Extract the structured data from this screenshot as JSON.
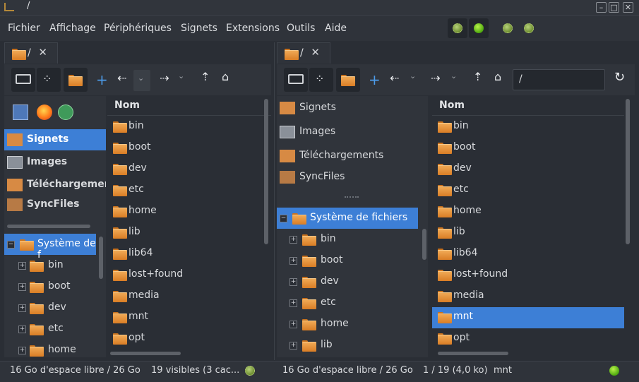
{
  "window": {
    "title": "/"
  },
  "menu": [
    "Fichier",
    "Affichage",
    "Périphériques",
    "Signets",
    "Extensions",
    "Outils",
    "Aide"
  ],
  "left": {
    "tab_label": "/",
    "places": [
      "Signets",
      "Images",
      "Téléchargemen",
      "SyncFiles"
    ],
    "tree_root": "Système de f",
    "tree_items": [
      "bin",
      "boot",
      "dev",
      "etc",
      "home"
    ],
    "column_header": "Nom",
    "files": [
      "bin",
      "boot",
      "dev",
      "etc",
      "home",
      "lib",
      "lib64",
      "lost+found",
      "media",
      "mnt",
      "opt"
    ],
    "status_free": "16 Go d'espace libre / 26 Go",
    "status_count": "19 visibles (3 cac..."
  },
  "right": {
    "tab_label": "/",
    "path_value": "/",
    "places": [
      "Signets",
      "Images",
      "Téléchargements",
      "SyncFiles"
    ],
    "tree_root": "Système de fichiers",
    "tree_items": [
      "bin",
      "boot",
      "dev",
      "etc",
      "home",
      "lib"
    ],
    "column_header": "Nom",
    "files": [
      "bin",
      "boot",
      "dev",
      "etc",
      "home",
      "lib",
      "lib64",
      "lost+found",
      "media",
      "mnt",
      "opt"
    ],
    "selected_file": "mnt",
    "status_free": "16 Go d'espace libre / 26 Go",
    "status_selection": "1 / 19 (4,0 ko)",
    "status_name": "mnt"
  },
  "colors": {
    "selection": "#3d7fd6",
    "folder": "#e8943a",
    "led_green": "#66cc1a"
  }
}
